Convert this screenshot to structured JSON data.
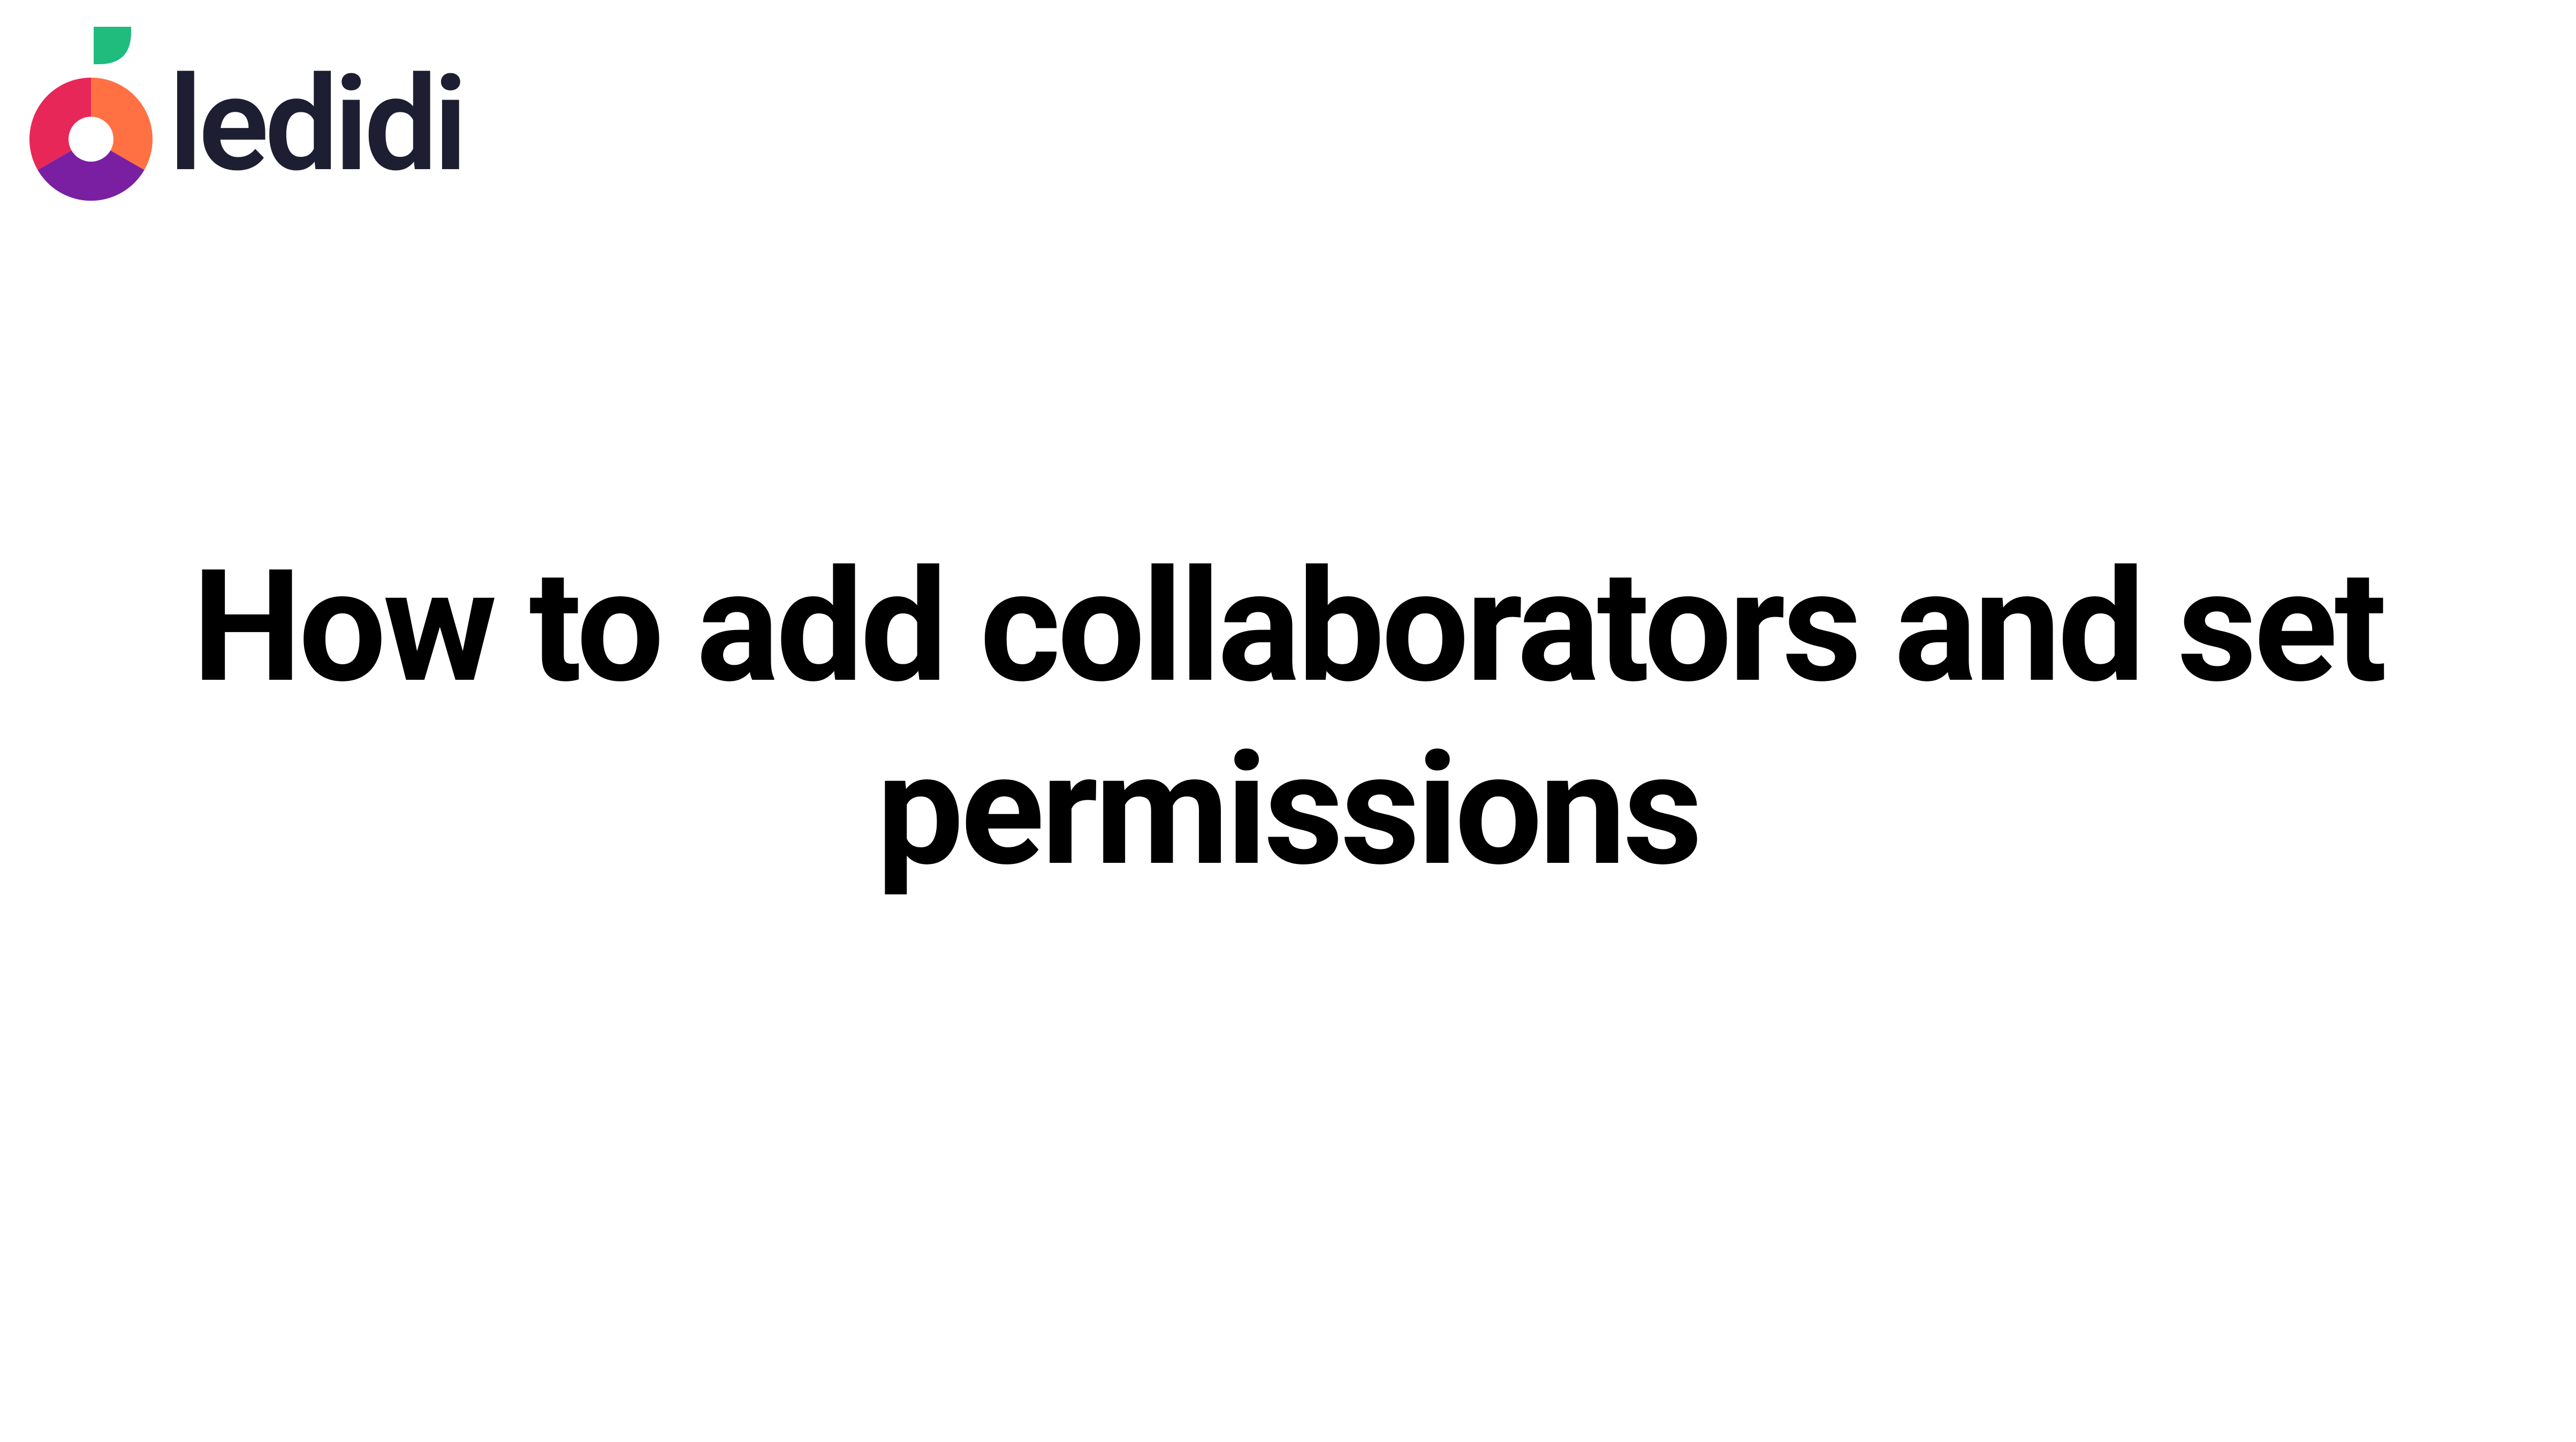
{
  "brand": {
    "name": "ledidi",
    "colors": {
      "leaf": "#1fbc7e",
      "circle_top": "#e82759",
      "circle_bottom_left": "#7b1fa2",
      "circle_bottom_right": "#ff7043",
      "circle_center": "#ffffff",
      "wordmark": "#1e1e32"
    }
  },
  "title": "How to add collaborators and set permissions"
}
